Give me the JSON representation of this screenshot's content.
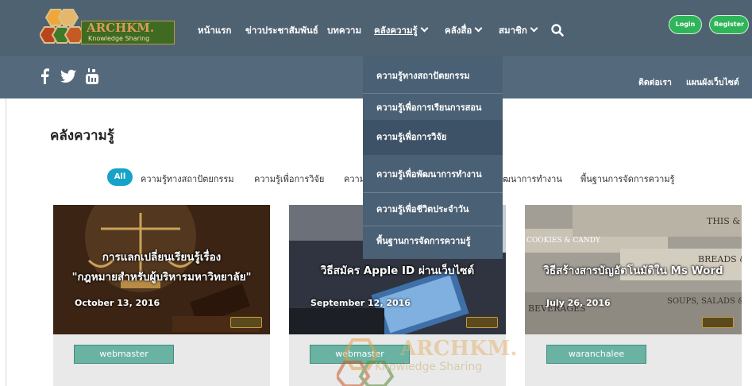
{
  "brand": {
    "name": "ARCHKM.",
    "tagline": "Knowledge Sharing"
  },
  "nav": {
    "items": [
      "หน้าแรก",
      "ข่าวประชาสัมพันธ์",
      "บทความ",
      "คลังความรู้",
      "คลังสื่อ",
      "สมาชิก"
    ],
    "login": "Login",
    "register": "Register"
  },
  "subnav": {
    "contact": "ติดต่อเรา",
    "sitemap": "แผนผังเว็บไซต์"
  },
  "dropdown": {
    "items": [
      "ความรู้ทางสถาปัตยกรรม",
      "ความรู้เพื่อการเรียนการสอน",
      "ความรู้เพื่อการวิจัย",
      "ความรู้เพื่อพัฒนาการทำงาน",
      "ความรู้เพื่อชีวิตประจำวัน",
      "พื้นฐานการจัดการความรู้"
    ]
  },
  "page": {
    "title": "คลังความรู้"
  },
  "filters": {
    "all": "All",
    "items": [
      "ความรู้ทางสถาปัตยกรรม",
      "ความรู้เพื่อการวิจัย",
      "ความ",
      "ฒนาการทำงาน",
      "พื้นฐานการจัดการความรู้"
    ]
  },
  "cards": [
    {
      "title_line1": "การแลกเปลี่ยนเรียนรู้เรื่อง",
      "title_line2": "\"กฎหมายสำหรับผู้บริหารมหาวิทยาลัย\"",
      "date": "October 13, 2016",
      "author": "webmaster"
    },
    {
      "title_line1": "วิธีสมัคร Apple ID ผ่านเว็บไซต์",
      "date": "September 12, 2016",
      "author": "webmaster"
    },
    {
      "title_line1": "วิธีสร้างสารบัญอัตโนมัติใน Ms Word",
      "date": "July 26, 2016",
      "author": "waranchalee",
      "bg_texts": [
        "THIS & T",
        "COOKIES & CANDY",
        "BREADS &",
        "BEVERAGES",
        "SOUPS, SALADS &"
      ]
    }
  ],
  "watermark": {
    "name": "ARCHKM.",
    "tagline": "Knowledge Sharing"
  },
  "colors": {
    "topbar": "#4f6272",
    "subbar": "#546a7c",
    "dropdown": "#4a6074",
    "accent_green": "#2fb45a",
    "filter_active": "#17a2c8",
    "author_tag": "#6ab3a3"
  }
}
